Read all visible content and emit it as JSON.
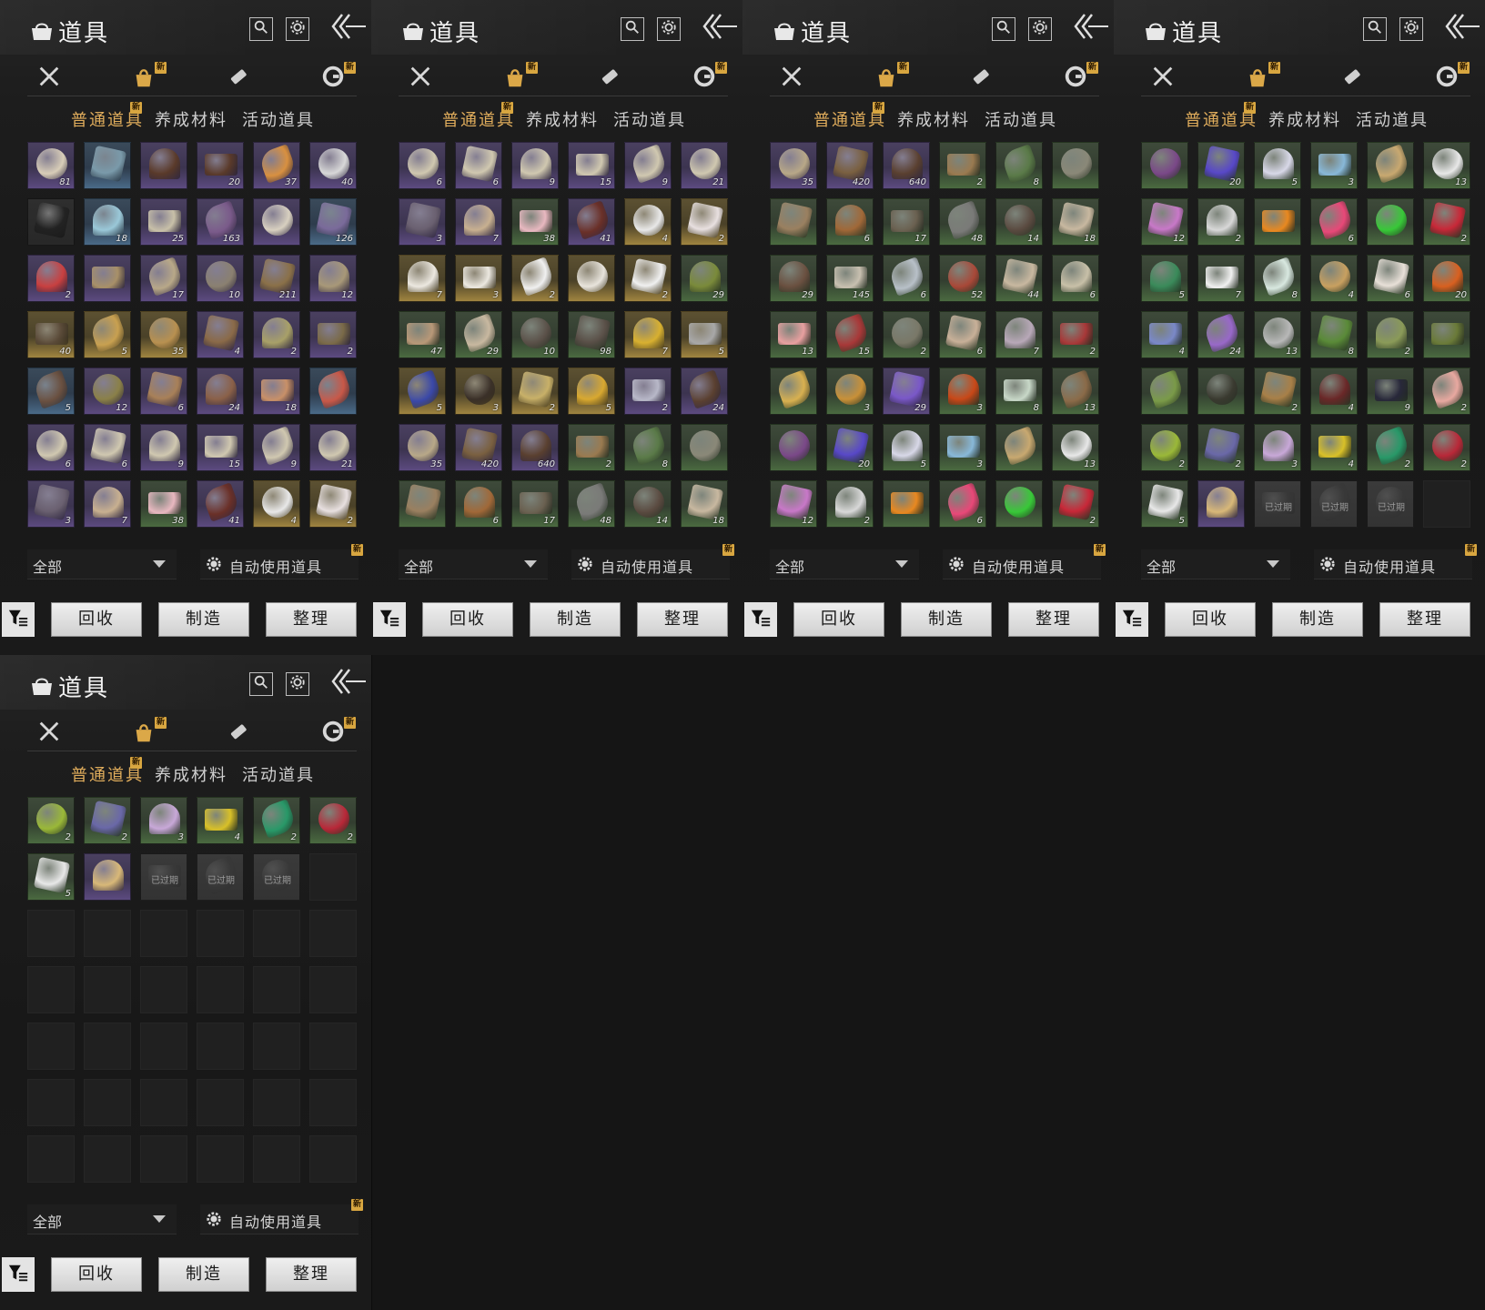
{
  "ui": {
    "title": "道具",
    "tabs": [
      "普通道具",
      "养成材料",
      "活动道具"
    ],
    "filter": "全部",
    "auto_use": "自动使用道具",
    "buttons": [
      "回收",
      "制造",
      "整理"
    ],
    "new_badge": "新",
    "expired": "已过期",
    "icons": {
      "title": "bag-icon",
      "search": "search-icon",
      "settings": "gear-icon",
      "back": "double-chevron-left-icon",
      "categories": [
        "crossed-swords-icon",
        "bag-icon",
        "scroll-icon",
        "coin-icon"
      ],
      "sort": "filter-sort-icon"
    }
  },
  "panels": [
    {
      "items": [
        {
          "c": "#d8cdb8",
          "r": "purple",
          "q": "81"
        },
        {
          "c": "#7a9aaa",
          "r": "blue",
          "q": ""
        },
        {
          "c": "#5a3a2a",
          "r": "purple",
          "q": ""
        },
        {
          "c": "#5a3a2a",
          "r": "purple",
          "q": "20"
        },
        {
          "c": "#d89040",
          "r": "purple",
          "q": "37"
        },
        {
          "c": "#d8d8d8",
          "r": "purple",
          "q": "40"
        },
        {
          "c": "#222",
          "r": "dark",
          "q": ""
        },
        {
          "c": "#9ac8d8",
          "r": "blue",
          "q": "18"
        },
        {
          "c": "#c8c0a8",
          "r": "purple",
          "q": "25"
        },
        {
          "c": "#7a5a8a",
          "r": "purple",
          "q": "163"
        },
        {
          "c": "#d8d0c0",
          "r": "purple",
          "q": ""
        },
        {
          "c": "#7a6a9a",
          "r": "blue",
          "q": "126"
        },
        {
          "c": "#c84040",
          "r": "purple",
          "q": "2"
        },
        {
          "c": "#a89068",
          "r": "purple",
          "q": ""
        },
        {
          "c": "#b8a888",
          "r": "purple",
          "q": "17"
        },
        {
          "c": "#8a8070",
          "r": "purple",
          "q": "10"
        },
        {
          "c": "#8a7048",
          "r": "purple",
          "q": "211"
        },
        {
          "c": "#a89878",
          "r": "purple",
          "q": "12"
        },
        {
          "c": "#5a4a38",
          "r": "gold",
          "q": "40"
        },
        {
          "c": "#c8a050",
          "r": "gold",
          "q": "5"
        },
        {
          "c": "#b89050",
          "r": "gold",
          "q": "35"
        },
        {
          "c": "#8a6a48",
          "r": "purple",
          "q": "4"
        },
        {
          "c": "#a8a068",
          "r": "purple",
          "q": "2"
        },
        {
          "c": "#7a6a48",
          "r": "purple",
          "q": "2"
        },
        {
          "c": "#6a5040",
          "r": "blue",
          "q": "5"
        },
        {
          "c": "#8a8048",
          "r": "purple",
          "q": "12"
        },
        {
          "c": "#a88058",
          "r": "purple",
          "q": "6"
        },
        {
          "c": "#8a6048",
          "r": "purple",
          "q": "24"
        },
        {
          "c": "#c89068",
          "r": "purple",
          "q": "18"
        },
        {
          "c": "#c85848",
          "r": "blue",
          "q": ""
        },
        {
          "c": "#d0c8b0",
          "r": "purple",
          "q": "6"
        },
        {
          "c": "#d0c8b0",
          "r": "purple",
          "q": "6"
        },
        {
          "c": "#d0c8b0",
          "r": "purple",
          "q": "9"
        },
        {
          "c": "#d0c8b0",
          "r": "purple",
          "q": "15"
        },
        {
          "c": "#d0c8b0",
          "r": "purple",
          "q": "9"
        },
        {
          "c": "#d0c8b0",
          "r": "purple",
          "q": "21"
        },
        {
          "c": "#6a6070",
          "r": "purple",
          "q": "3"
        },
        {
          "c": "#c8b090",
          "r": "purple",
          "q": "7"
        },
        {
          "c": "#e8b8c0",
          "r": "green",
          "q": "38"
        },
        {
          "c": "#6a3028",
          "r": "purple",
          "q": "41"
        },
        {
          "c": "#e8e8e8",
          "r": "gold",
          "q": "4"
        },
        {
          "c": "#e8e0e0",
          "r": "gold",
          "q": "2"
        }
      ]
    },
    {
      "items": [
        {
          "c": "#d0c8b0",
          "r": "purple",
          "q": "6"
        },
        {
          "c": "#d0c8b0",
          "r": "purple",
          "q": "6"
        },
        {
          "c": "#d0c8b0",
          "r": "purple",
          "q": "9"
        },
        {
          "c": "#d0c8b0",
          "r": "purple",
          "q": "15"
        },
        {
          "c": "#d0c8b0",
          "r": "purple",
          "q": "9"
        },
        {
          "c": "#d0c8b0",
          "r": "purple",
          "q": "21"
        },
        {
          "c": "#6a6070",
          "r": "purple",
          "q": "3"
        },
        {
          "c": "#c8b090",
          "r": "purple",
          "q": "7"
        },
        {
          "c": "#e8b8c0",
          "r": "green",
          "q": "38"
        },
        {
          "c": "#6a3028",
          "r": "purple",
          "q": "41"
        },
        {
          "c": "#e8e8e8",
          "r": "gold",
          "q": "4"
        },
        {
          "c": "#e8e0e0",
          "r": "gold",
          "q": "2"
        },
        {
          "c": "#ece8e0",
          "r": "gold",
          "q": "7"
        },
        {
          "c": "#ece8e0",
          "r": "gold",
          "q": "3"
        },
        {
          "c": "#f0f0f0",
          "r": "gold",
          "q": "2"
        },
        {
          "c": "#e8e4dc",
          "r": "gold",
          "q": ""
        },
        {
          "c": "#f0f0f0",
          "r": "gold",
          "q": "2"
        },
        {
          "c": "#7a8a3a",
          "r": "green",
          "q": "29"
        },
        {
          "c": "#b89878",
          "r": "green",
          "q": "47"
        },
        {
          "c": "#c8b8a0",
          "r": "green",
          "q": "29"
        },
        {
          "c": "#5a5048",
          "r": "green",
          "q": "10"
        },
        {
          "c": "#5a5048",
          "r": "green",
          "q": "98"
        },
        {
          "c": "#d8b030",
          "r": "gold",
          "q": "7"
        },
        {
          "c": "#a8a8a8",
          "r": "gold",
          "q": "5"
        },
        {
          "c": "#3a48a8",
          "r": "gold",
          "q": "5"
        },
        {
          "c": "#3a3028",
          "r": "gold",
          "q": "3"
        },
        {
          "c": "#c8b068",
          "r": "gold",
          "q": "2"
        },
        {
          "c": "#d8a830",
          "r": "gold",
          "q": "5"
        },
        {
          "c": "#b8b8c8",
          "r": "purple",
          "q": "2"
        },
        {
          "c": "#5a4030",
          "r": "purple",
          "q": "24"
        },
        {
          "c": "#b8a888",
          "r": "purple",
          "q": "35"
        },
        {
          "c": "#7a6040",
          "r": "purple",
          "q": "420"
        },
        {
          "c": "#5a4030",
          "r": "purple",
          "q": "640"
        },
        {
          "c": "#9a7a50",
          "r": "green",
          "q": "2"
        },
        {
          "c": "#5a7a48",
          "r": "green",
          "q": "8"
        },
        {
          "c": "#8a8878",
          "r": "green",
          "q": ""
        },
        {
          "c": "#9a8060",
          "r": "green",
          "q": ""
        },
        {
          "c": "#a06838",
          "r": "green",
          "q": "6"
        },
        {
          "c": "#6a6050",
          "r": "green",
          "q": "17"
        },
        {
          "c": "#7a7a78",
          "r": "green",
          "q": "48"
        },
        {
          "c": "#5a4a40",
          "r": "green",
          "q": "14"
        },
        {
          "c": "#c8b8a0",
          "r": "green",
          "q": "18"
        }
      ]
    },
    {
      "items": [
        {
          "c": "#b8a888",
          "r": "purple",
          "q": "35"
        },
        {
          "c": "#7a6040",
          "r": "purple",
          "q": "420"
        },
        {
          "c": "#5a4030",
          "r": "purple",
          "q": "640"
        },
        {
          "c": "#9a7a50",
          "r": "green",
          "q": "2"
        },
        {
          "c": "#5a7a48",
          "r": "green",
          "q": "8"
        },
        {
          "c": "#8a8878",
          "r": "green",
          "q": ""
        },
        {
          "c": "#9a8060",
          "r": "green",
          "q": ""
        },
        {
          "c": "#a06838",
          "r": "green",
          "q": "6"
        },
        {
          "c": "#6a6050",
          "r": "green",
          "q": "17"
        },
        {
          "c": "#7a7a78",
          "r": "green",
          "q": "48"
        },
        {
          "c": "#5a4a40",
          "r": "green",
          "q": "14"
        },
        {
          "c": "#c8b8a0",
          "r": "green",
          "q": "18"
        },
        {
          "c": "#6a5040",
          "r": "green",
          "q": "29"
        },
        {
          "c": "#c8c0b0",
          "r": "green",
          "q": "145"
        },
        {
          "c": "#b8c0c8",
          "r": "green",
          "q": "6"
        },
        {
          "c": "#a84838",
          "r": "green",
          "q": "52"
        },
        {
          "c": "#c8b8a0",
          "r": "green",
          "q": "44"
        },
        {
          "c": "#c8c0a8",
          "r": "green",
          "q": "6"
        },
        {
          "c": "#e8a0a0",
          "r": "green",
          "q": "13"
        },
        {
          "c": "#a83838",
          "r": "green",
          "q": "15"
        },
        {
          "c": "#7a7868",
          "r": "green",
          "q": "2"
        },
        {
          "c": "#c8b098",
          "r": "green",
          "q": "6"
        },
        {
          "c": "#b8a8b8",
          "r": "green",
          "q": "7"
        },
        {
          "c": "#a83838",
          "r": "green",
          "q": "2"
        },
        {
          "c": "#d8b050",
          "r": "green",
          "q": ""
        },
        {
          "c": "#c89038",
          "r": "green",
          "q": "3"
        },
        {
          "c": "#7a58c8",
          "r": "purple",
          "q": "29"
        },
        {
          "c": "#c84818",
          "r": "green",
          "q": "3"
        },
        {
          "c": "#c8d8c8",
          "r": "green",
          "q": "8"
        },
        {
          "c": "#8a6a48",
          "r": "green",
          "q": "13"
        },
        {
          "c": "#7a4888",
          "r": "green",
          "q": ""
        },
        {
          "c": "#5848c8",
          "r": "green",
          "q": "20"
        },
        {
          "c": "#d8d8e8",
          "r": "green",
          "q": "5"
        },
        {
          "c": "#88b8d8",
          "r": "green",
          "q": "3"
        },
        {
          "c": "#c8a870",
          "r": "green",
          "q": ""
        },
        {
          "c": "#e8e8e8",
          "r": "green",
          "q": "13"
        },
        {
          "c": "#c878c8",
          "r": "green",
          "q": "12"
        },
        {
          "c": "#d8d8d8",
          "r": "green",
          "q": "2"
        },
        {
          "c": "#e88820",
          "r": "green",
          "q": ""
        },
        {
          "c": "#e84878",
          "r": "green",
          "q": "6"
        },
        {
          "c": "#38c838",
          "r": "green",
          "q": ""
        },
        {
          "c": "#c82838",
          "r": "green",
          "q": "2"
        }
      ]
    },
    {
      "items": [
        {
          "c": "#7a4888",
          "r": "green",
          "q": ""
        },
        {
          "c": "#5848c8",
          "r": "green",
          "q": "20"
        },
        {
          "c": "#d8d8e8",
          "r": "green",
          "q": "5"
        },
        {
          "c": "#88b8d8",
          "r": "green",
          "q": "3"
        },
        {
          "c": "#c8a870",
          "r": "green",
          "q": ""
        },
        {
          "c": "#e8e8e8",
          "r": "green",
          "q": "13"
        },
        {
          "c": "#c878c8",
          "r": "green",
          "q": "12"
        },
        {
          "c": "#d8d8d8",
          "r": "green",
          "q": "2"
        },
        {
          "c": "#e88820",
          "r": "green",
          "q": ""
        },
        {
          "c": "#e84878",
          "r": "green",
          "q": "6"
        },
        {
          "c": "#38c838",
          "r": "green",
          "q": ""
        },
        {
          "c": "#c82838",
          "r": "green",
          "q": "2"
        },
        {
          "c": "#3a8a5a",
          "r": "green",
          "q": "5"
        },
        {
          "c": "#f0f0f0",
          "r": "green",
          "q": "7"
        },
        {
          "c": "#d8e8e0",
          "r": "green",
          "q": "8"
        },
        {
          "c": "#c8a060",
          "r": "green",
          "q": "4"
        },
        {
          "c": "#e8e0d8",
          "r": "green",
          "q": "6"
        },
        {
          "c": "#d86020",
          "r": "green",
          "q": "20"
        },
        {
          "c": "#7a88c8",
          "r": "green",
          "q": "4"
        },
        {
          "c": "#9868c8",
          "r": "green",
          "q": "24"
        },
        {
          "c": "#b8b8b8",
          "r": "green",
          "q": "13"
        },
        {
          "c": "#5a8a38",
          "r": "green",
          "q": "8"
        },
        {
          "c": "#8a9a58",
          "r": "green",
          "q": "2"
        },
        {
          "c": "#6a7a38",
          "r": "green",
          "q": ""
        },
        {
          "c": "#7a9a48",
          "r": "green",
          "q": ""
        },
        {
          "c": "#3a3a30",
          "r": "green",
          "q": ""
        },
        {
          "c": "#a88048",
          "r": "green",
          "q": "2"
        },
        {
          "c": "#6a2828",
          "r": "green",
          "q": "4"
        },
        {
          "c": "#28283a",
          "r": "green",
          "q": "9"
        },
        {
          "c": "#e8a8a0",
          "r": "green",
          "q": "2"
        },
        {
          "c": "#9ab838",
          "r": "green",
          "q": "2"
        },
        {
          "c": "#6a68a8",
          "r": "green",
          "q": "2"
        },
        {
          "c": "#c8a8d8",
          "r": "green",
          "q": "3"
        },
        {
          "c": "#d8c028",
          "r": "green",
          "q": "4"
        },
        {
          "c": "#289868",
          "r": "green",
          "q": "2"
        },
        {
          "c": "#b82838",
          "r": "green",
          "q": "2"
        },
        {
          "c": "#e8e8e8",
          "r": "green",
          "q": "5"
        },
        {
          "c": "#d8b878",
          "r": "purple",
          "q": ""
        },
        {
          "c": "#3a3a3a",
          "r": "grey",
          "q": "",
          "x": 1
        },
        {
          "c": "#3a3a3a",
          "r": "grey",
          "q": "",
          "x": 1
        },
        {
          "c": "#3a3a3a",
          "r": "grey",
          "q": "",
          "x": 1
        },
        {
          "e": 1
        }
      ]
    },
    {
      "items": [
        {
          "c": "#9ab838",
          "r": "green",
          "q": "2"
        },
        {
          "c": "#6a68a8",
          "r": "green",
          "q": "2"
        },
        {
          "c": "#c8a8d8",
          "r": "green",
          "q": "3"
        },
        {
          "c": "#d8c028",
          "r": "green",
          "q": "4"
        },
        {
          "c": "#289868",
          "r": "green",
          "q": "2"
        },
        {
          "c": "#b82838",
          "r": "green",
          "q": "2"
        },
        {
          "c": "#e8e8e8",
          "r": "green",
          "q": "5"
        },
        {
          "c": "#d8b878",
          "r": "purple",
          "q": ""
        },
        {
          "c": "#3a3a3a",
          "r": "grey",
          "q": "",
          "x": 1
        },
        {
          "c": "#3a3a3a",
          "r": "grey",
          "q": "",
          "x": 1
        },
        {
          "c": "#3a3a3a",
          "r": "grey",
          "q": "",
          "x": 1
        },
        {
          "e": 1
        },
        {
          "e": 1
        },
        {
          "e": 1
        },
        {
          "e": 1
        },
        {
          "e": 1
        },
        {
          "e": 1
        },
        {
          "e": 1
        },
        {
          "e": 1
        },
        {
          "e": 1
        },
        {
          "e": 1
        },
        {
          "e": 1
        },
        {
          "e": 1
        },
        {
          "e": 1
        },
        {
          "e": 1
        },
        {
          "e": 1
        },
        {
          "e": 1
        },
        {
          "e": 1
        },
        {
          "e": 1
        },
        {
          "e": 1
        },
        {
          "e": 1
        },
        {
          "e": 1
        },
        {
          "e": 1
        },
        {
          "e": 1
        },
        {
          "e": 1
        },
        {
          "e": 1
        },
        {
          "e": 1
        },
        {
          "e": 1
        },
        {
          "e": 1
        },
        {
          "e": 1
        },
        {
          "e": 1
        },
        {
          "e": 1
        }
      ]
    }
  ]
}
